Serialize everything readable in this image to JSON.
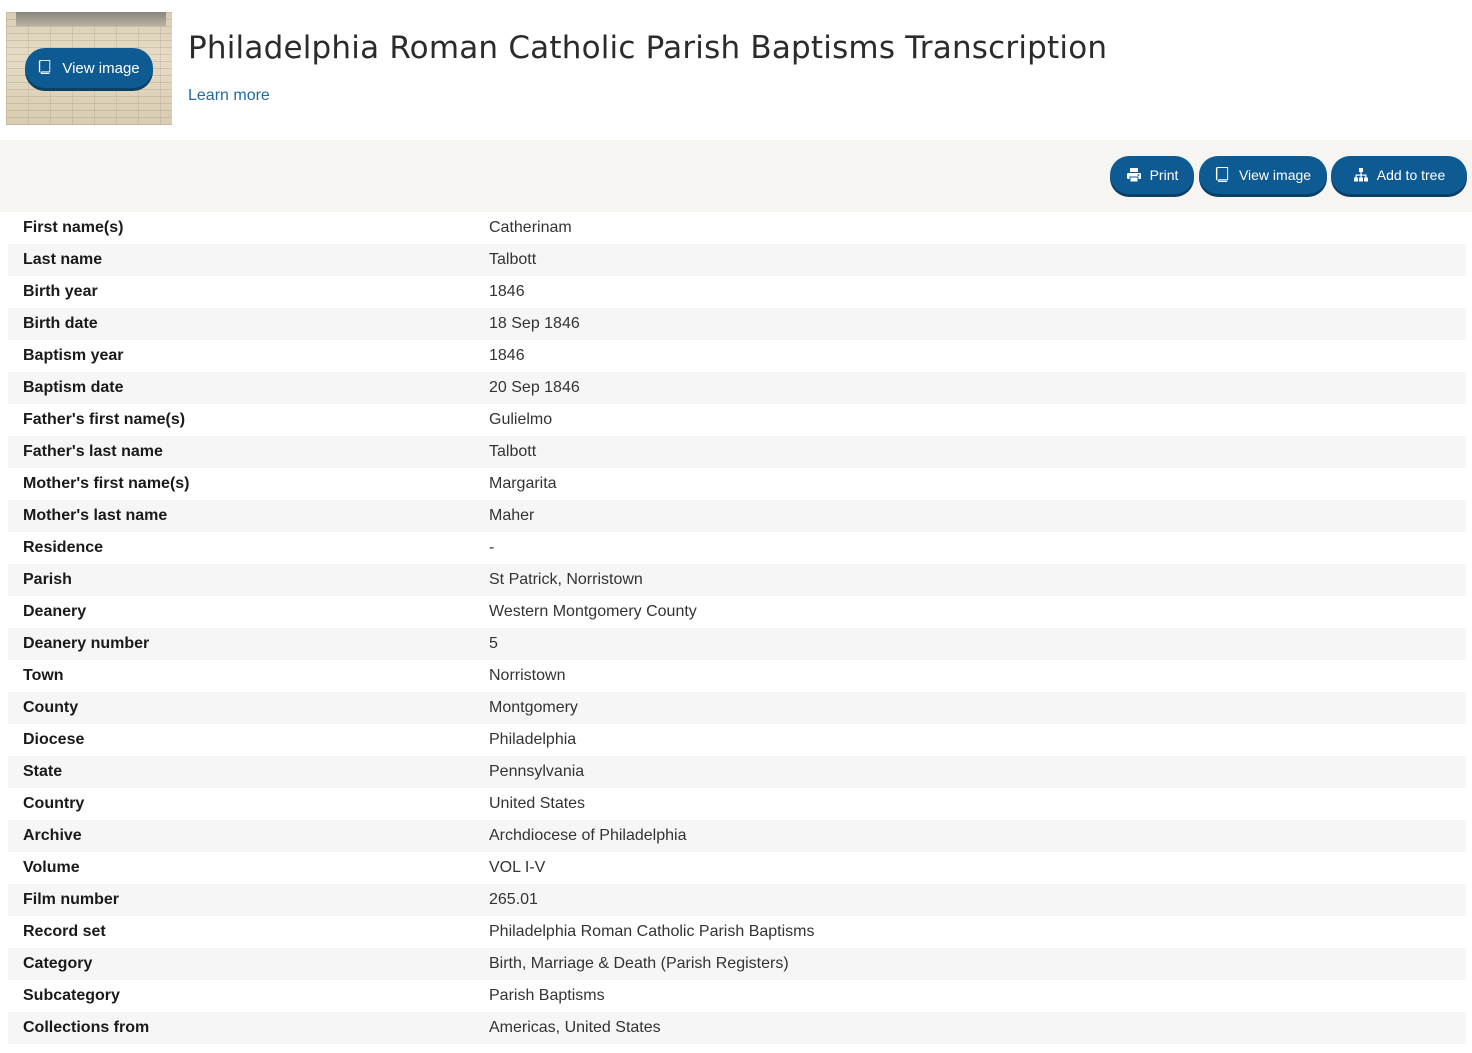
{
  "header": {
    "title": "Philadelphia Roman Catholic Parish Baptisms Transcription",
    "learn_more": "Learn more",
    "thumb_button": "View image"
  },
  "toolbar": {
    "print": "Print",
    "view_image": "View image",
    "add_to_tree": "Add to tree"
  },
  "colors": {
    "button_bg": "#0e5b93",
    "link": "#1f6aa6",
    "toolbar_bg": "#f6f5f1"
  },
  "icons": {
    "print": "printer-icon",
    "view_image": "book-icon",
    "add_to_tree": "sitemap-icon"
  },
  "record": [
    {
      "label": "First name(s)",
      "value": "Catherinam"
    },
    {
      "label": "Last name",
      "value": "Talbott"
    },
    {
      "label": "Birth year",
      "value": "1846"
    },
    {
      "label": "Birth date",
      "value": "18 Sep 1846"
    },
    {
      "label": "Baptism year",
      "value": "1846"
    },
    {
      "label": "Baptism date",
      "value": "20 Sep 1846"
    },
    {
      "label": "Father's first name(s)",
      "value": "Gulielmo"
    },
    {
      "label": "Father's last name",
      "value": "Talbott"
    },
    {
      "label": "Mother's first name(s)",
      "value": "Margarita"
    },
    {
      "label": "Mother's last name",
      "value": "Maher"
    },
    {
      "label": "Residence",
      "value": "-"
    },
    {
      "label": "Parish",
      "value": "St Patrick, Norristown"
    },
    {
      "label": "Deanery",
      "value": "Western Montgomery County"
    },
    {
      "label": "Deanery number",
      "value": "5"
    },
    {
      "label": "Town",
      "value": "Norristown"
    },
    {
      "label": "County",
      "value": "Montgomery"
    },
    {
      "label": "Diocese",
      "value": "Philadelphia"
    },
    {
      "label": "State",
      "value": "Pennsylvania"
    },
    {
      "label": "Country",
      "value": "United States"
    },
    {
      "label": "Archive",
      "value": "Archdiocese of Philadelphia"
    },
    {
      "label": "Volume",
      "value": "VOL I-V"
    },
    {
      "label": "Film number",
      "value": "265.01"
    },
    {
      "label": "Record set",
      "value": "Philadelphia Roman Catholic Parish Baptisms"
    },
    {
      "label": "Category",
      "value": "Birth, Marriage & Death (Parish Registers)"
    },
    {
      "label": "Subcategory",
      "value": "Parish Baptisms"
    },
    {
      "label": "Collections from",
      "value": "Americas, United States"
    }
  ]
}
